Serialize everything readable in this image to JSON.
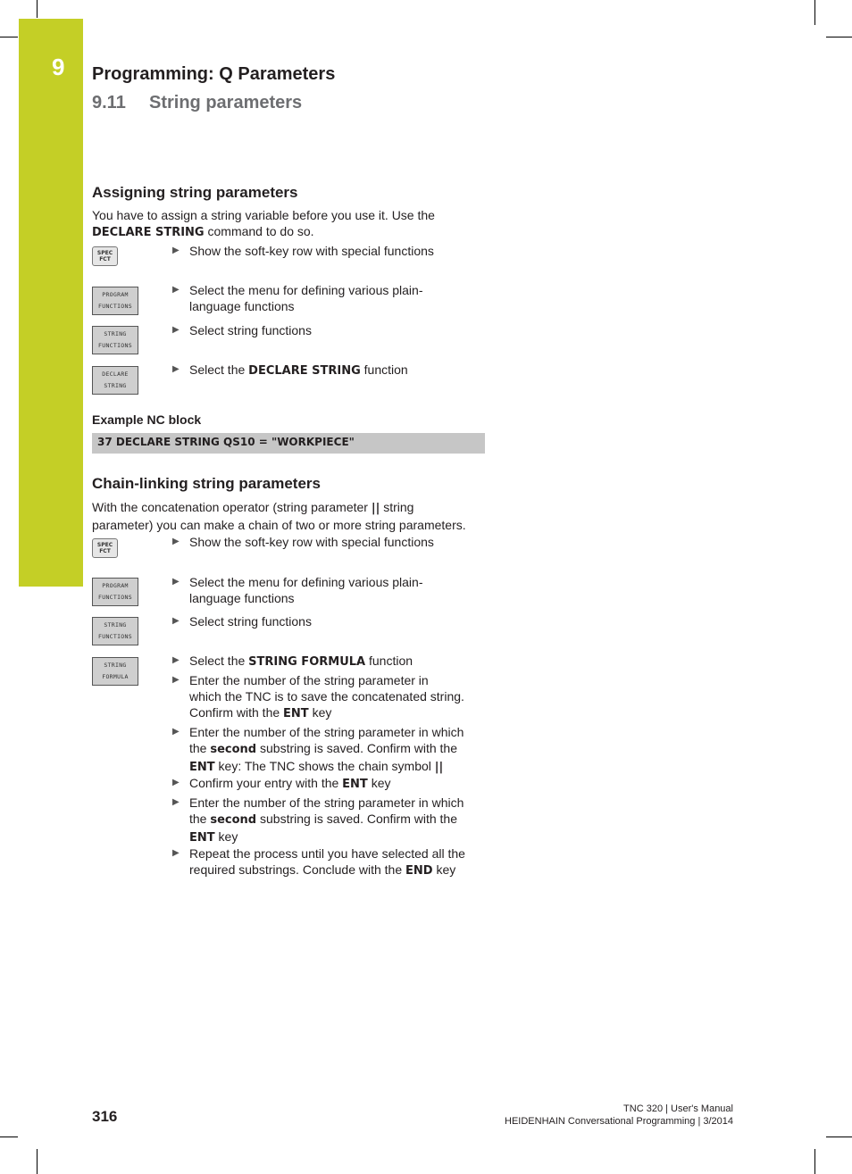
{
  "header": {
    "chapter_number": "9",
    "chapter_title": "Programming: Q Parameters",
    "section_number": "9.11",
    "section_title": "String parameters",
    "accent_color": "#c4cf26"
  },
  "assigning": {
    "heading": "Assigning string parameters",
    "intro_1": "You have to assign a string variable before you use it. Use the",
    "intro_2_bold": "DECLARE STRING",
    "intro_2_rest": " command to do so.",
    "steps": [
      {
        "key": [
          "SPEC",
          "FCT"
        ],
        "key_type": "hard-key",
        "text": "Show the soft-key row with special functions"
      },
      {
        "key": [
          "PROGRAM",
          "FUNCTIONS"
        ],
        "key_type": "soft-key",
        "text_1": "Select the menu for defining various plain-",
        "text_2": "language functions"
      },
      {
        "key": [
          "STRING",
          "FUNCTIONS"
        ],
        "key_type": "soft-key",
        "text": "Select string functions"
      },
      {
        "key": [
          "DECLARE",
          "STRING"
        ],
        "key_type": "soft-key",
        "text_pre": "Select the ",
        "text_bold": "DECLARE STRING",
        "text_post": " function"
      }
    ],
    "example_heading": "Example NC block",
    "example_code": "37 DECLARE STRING QS10 = \"WORKPIECE\""
  },
  "chaining": {
    "heading": "Chain-linking string parameters",
    "intro_1_pre": "With the concatenation operator (string parameter ",
    "intro_1_bold": "||",
    "intro_1_post": " string",
    "intro_2": "parameter) you can make a chain of two or more string parameters.",
    "steps": [
      {
        "key": [
          "SPEC",
          "FCT"
        ],
        "key_type": "hard-key",
        "text": "Show the soft-key row with special functions"
      },
      {
        "key": [
          "PROGRAM",
          "FUNCTIONS"
        ],
        "key_type": "soft-key",
        "text_1": "Select the menu for defining various plain-",
        "text_2": "language functions"
      },
      {
        "key": [
          "STRING",
          "FUNCTIONS"
        ],
        "key_type": "soft-key",
        "text": "Select string functions"
      },
      {
        "key": [
          "STRING",
          "FORMULA"
        ],
        "key_type": "soft-key",
        "text_pre": "Select the ",
        "text_bold": "STRING FORMULA",
        "text_post": " function"
      }
    ],
    "substeps": [
      {
        "l1": "Enter the number of the string parameter in",
        "l2": "which the TNC is to save the concatenated string.",
        "l3_pre": "Confirm with the ",
        "l3_bold": "ENT",
        "l3_post": " key"
      },
      {
        "l1": "Enter the number of the string parameter in which",
        "l2_pre": "the ",
        "l2_bold": "second",
        "l2_post": " substring is saved. Confirm with the",
        "l3_bold": "ENT",
        "l3_post": " key: The TNC shows the chain symbol ",
        "l3_bold2": "||"
      },
      {
        "l1_pre": "Confirm your entry with the ",
        "l1_bold": "ENT",
        "l1_post": " key"
      },
      {
        "l1": "Enter the number of the string parameter in which",
        "l2_pre": "the ",
        "l2_bold": "second",
        "l2_post": " substring is saved. Confirm with the",
        "l3_bold": "ENT",
        "l3_post": " key"
      },
      {
        "l1": "Repeat the process until you have selected all the",
        "l2_pre": "required substrings. Conclude with the ",
        "l2_bold": "END",
        "l2_post": " key"
      }
    ]
  },
  "footer": {
    "page_number": "316",
    "line_1": "TNC 320 | User's Manual",
    "line_2": "HEIDENHAIN Conversational Programming | 3/2014"
  }
}
